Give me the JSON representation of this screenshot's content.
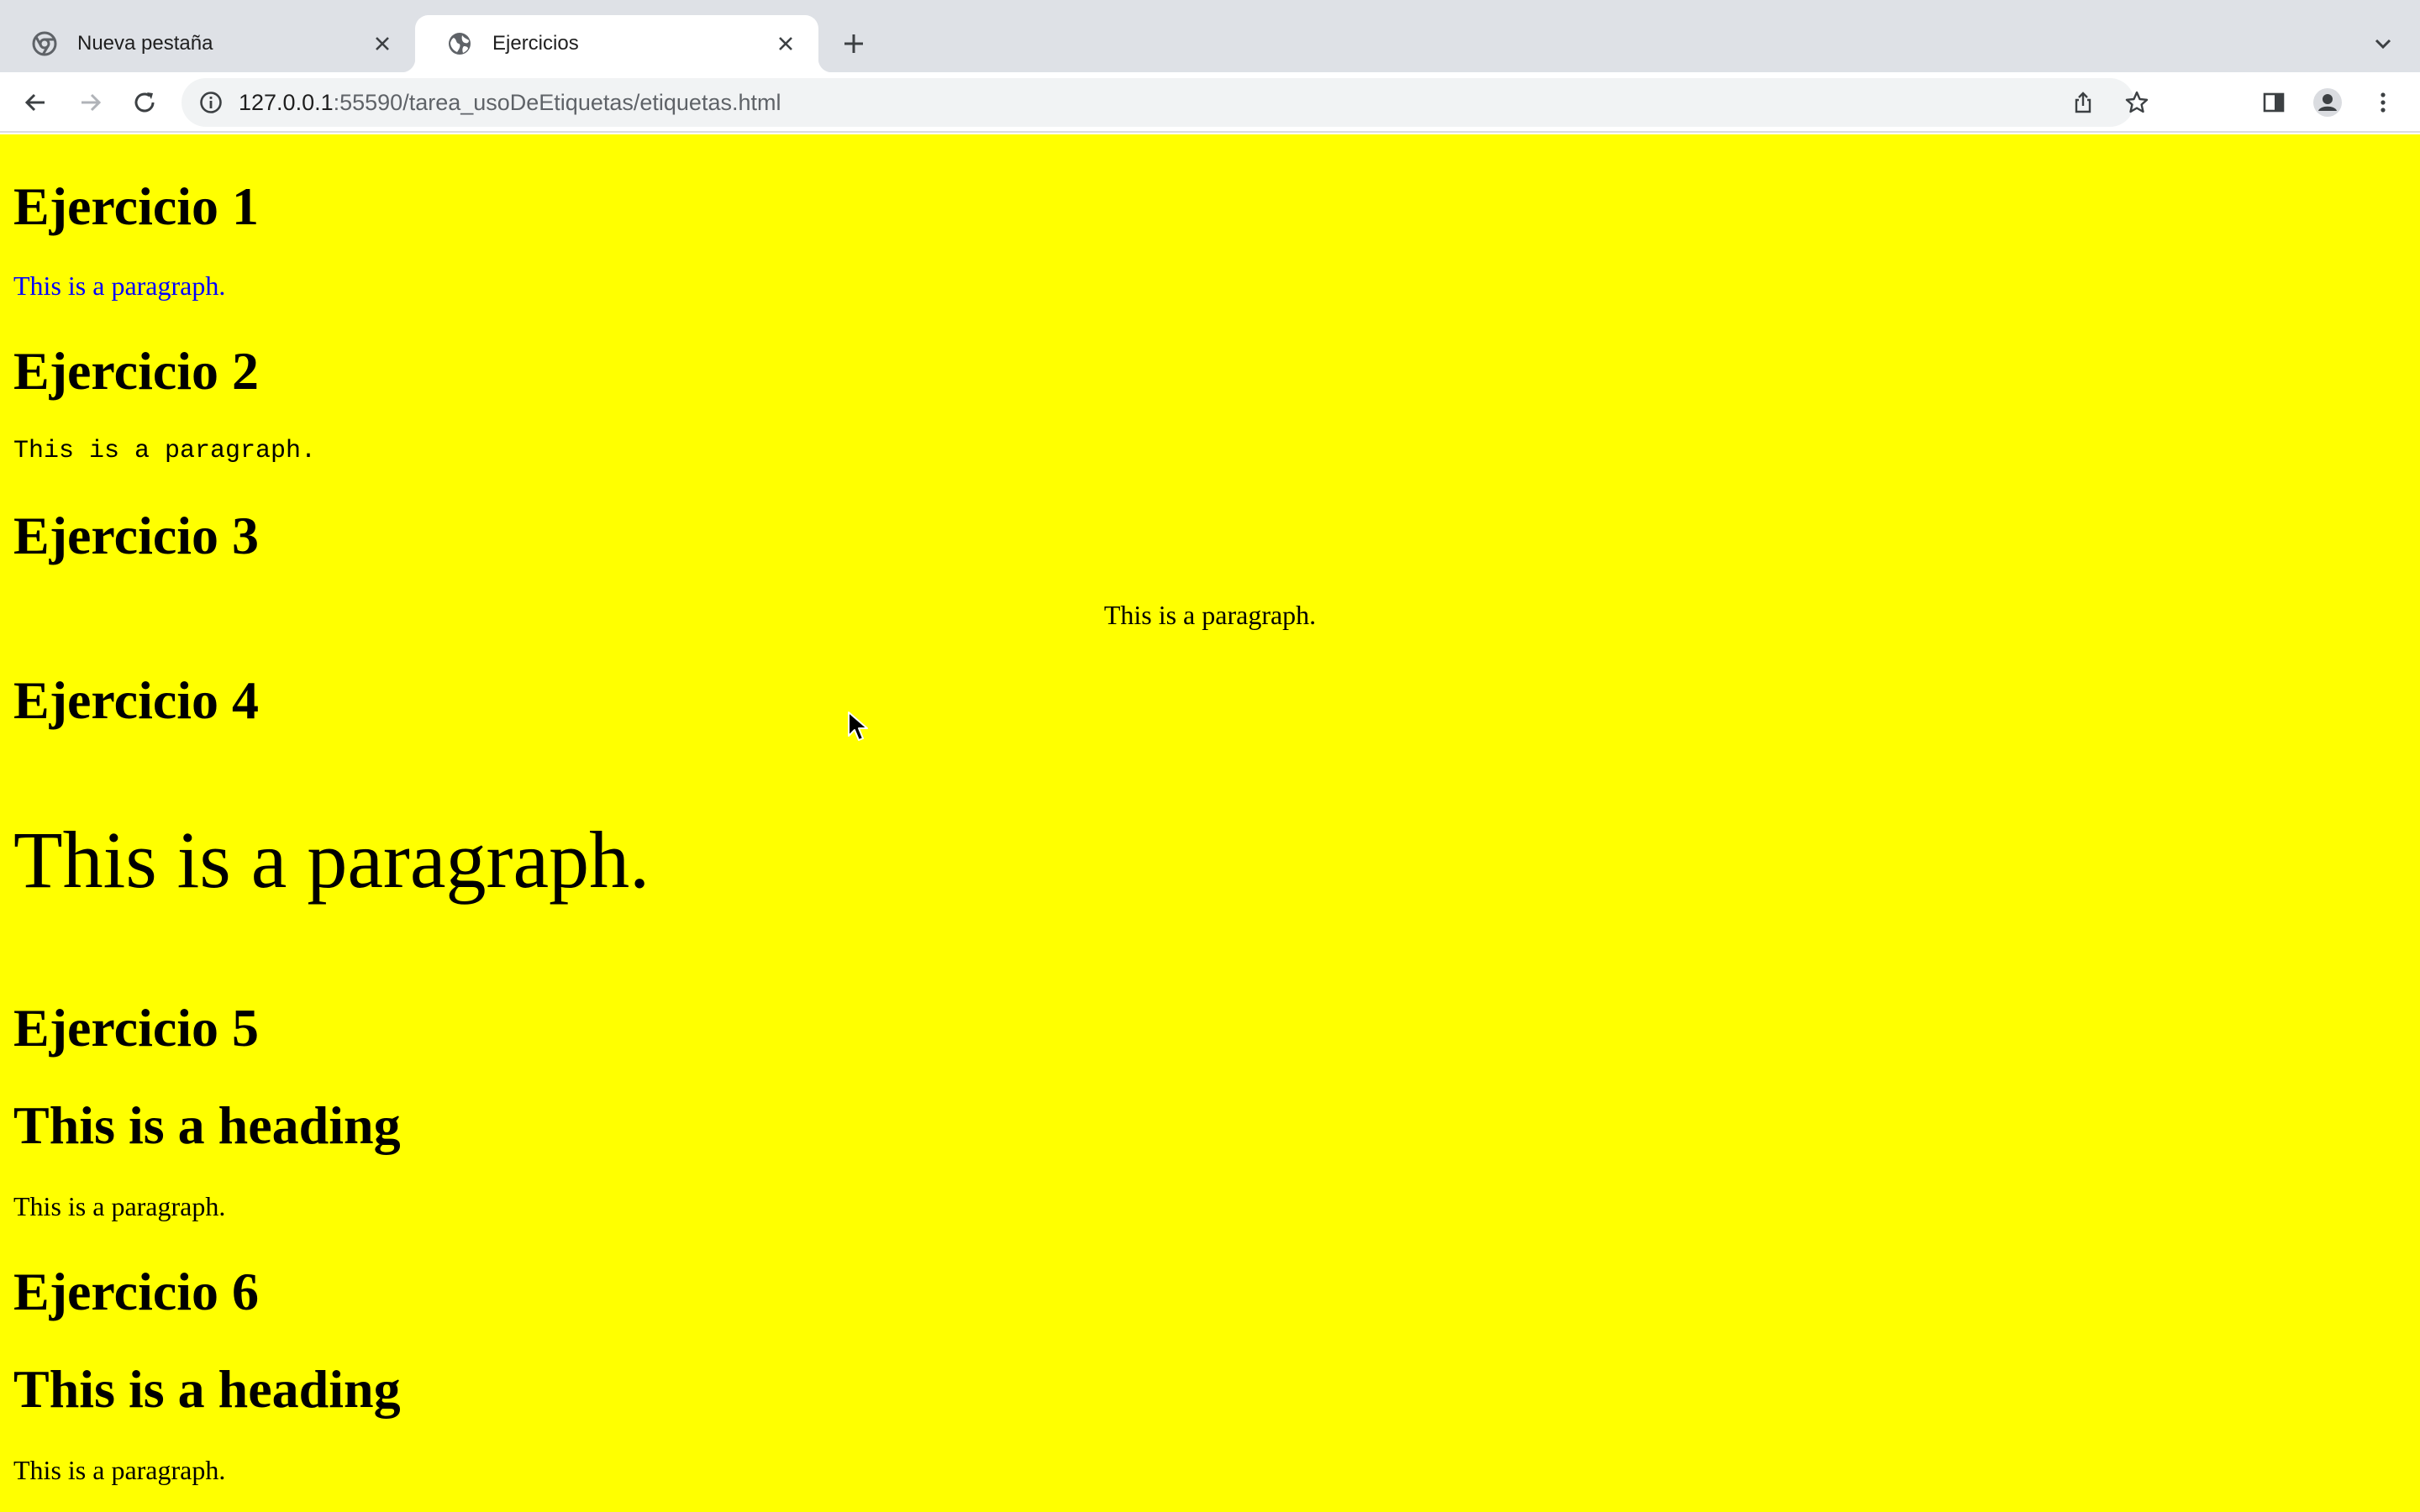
{
  "tabs": [
    {
      "title": "Nueva pestaña",
      "favicon": "chrome-icon",
      "active": false
    },
    {
      "title": "Ejercicios",
      "favicon": "globe-icon",
      "active": true
    }
  ],
  "toolbar": {
    "url_host": "127.0.0.1",
    "url_rest": ":55590/tarea_usoDeEtiquetas/etiquetas.html"
  },
  "page": {
    "background": "#ffff00",
    "ex1": {
      "heading": "Ejercicio 1",
      "paragraph": "This is a paragraph.",
      "paragraph_color": "#0000ff"
    },
    "ex2": {
      "heading": "Ejercicio 2",
      "paragraph": "This is a paragraph."
    },
    "ex3": {
      "heading": "Ejercicio 3",
      "paragraph": "This is a paragraph."
    },
    "ex4": {
      "heading": "Ejercicio 4",
      "paragraph": "This is a paragraph."
    },
    "ex5": {
      "heading": "Ejercicio 5",
      "subheading": "This is a heading",
      "paragraph": "This is a paragraph."
    },
    "ex6": {
      "heading": "Ejercicio 6",
      "subheading": "This is a heading",
      "paragraph": "This is a paragraph."
    }
  }
}
